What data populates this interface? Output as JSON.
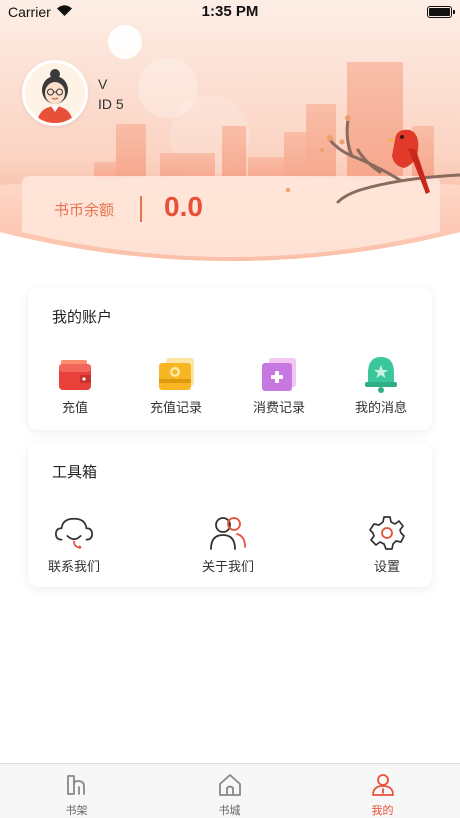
{
  "status_bar": {
    "carrier": "Carrier",
    "time": "1:35 PM"
  },
  "user": {
    "name": "V",
    "id_text": "ID 5"
  },
  "balance": {
    "label": "书币余额",
    "value": "0.0"
  },
  "account_section": {
    "title": "我的账户",
    "items": [
      {
        "label": "充值",
        "icon": "wallet-icon"
      },
      {
        "label": "充值记录",
        "icon": "recharge-record-icon"
      },
      {
        "label": "消费记录",
        "icon": "consume-record-icon"
      },
      {
        "label": "我的消息",
        "icon": "bell-icon"
      }
    ]
  },
  "tools_section": {
    "title": "工具箱",
    "items": [
      {
        "label": "联系我们",
        "icon": "customer-service-icon"
      },
      {
        "label": "关于我们",
        "icon": "about-us-icon"
      },
      {
        "label": "设置",
        "icon": "gear-icon"
      }
    ]
  },
  "tab_bar": {
    "tabs": [
      {
        "label": "书架",
        "icon": "bookshelf-icon",
        "active": false
      },
      {
        "label": "书城",
        "icon": "home-icon",
        "active": false
      },
      {
        "label": "我的",
        "icon": "profile-icon",
        "active": true
      }
    ]
  },
  "colors": {
    "accent": "#e8503a",
    "header_top": "#fde4d8",
    "header_bottom": "#f8b39b"
  }
}
